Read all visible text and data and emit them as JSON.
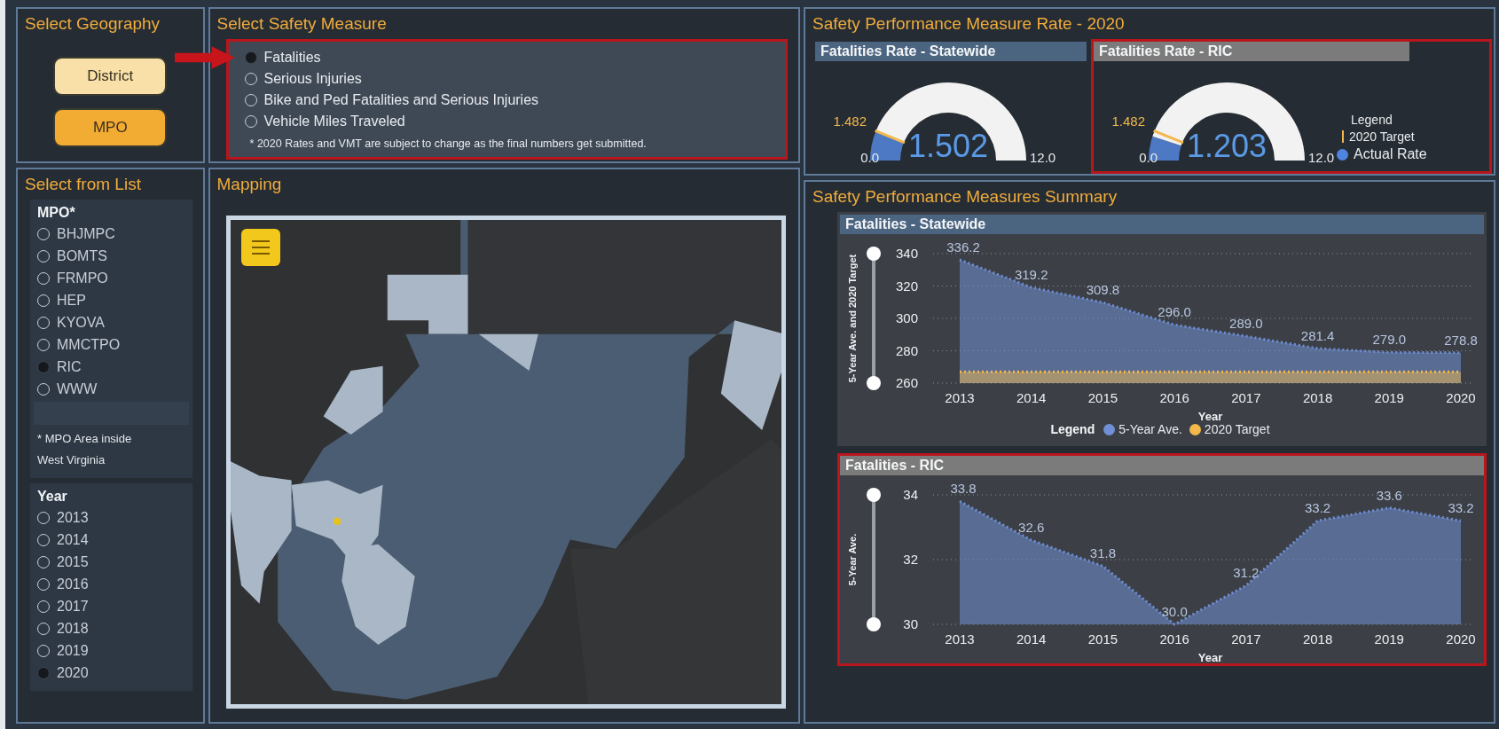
{
  "geography": {
    "title": "Select Geography",
    "buttons": [
      {
        "label": "District",
        "selected": false
      },
      {
        "label": "MPO",
        "selected": true
      }
    ]
  },
  "safety_measure": {
    "title": "Select Safety Measure",
    "highlighted": true,
    "options": [
      {
        "label": "Fatalities",
        "selected": true
      },
      {
        "label": "Serious Injuries",
        "selected": false
      },
      {
        "label": "Bike and Ped Fatalities and Serious Injuries",
        "selected": false
      },
      {
        "label": "Vehicle Miles Traveled",
        "selected": false
      }
    ],
    "note": "* 2020 Rates and VMT are subject to change as the final numbers get submitted."
  },
  "rate_panel": {
    "title": "Safety Performance Measure Rate - 2020",
    "gauges": [
      {
        "title": "Fatalities Rate - Statewide",
        "color": "#4b6480",
        "highlighted": false,
        "value": "1.502",
        "min": "0.0",
        "max": "12.0",
        "target": {
          "label": "1.482"
        }
      },
      {
        "title": "Fatalities Rate - RIC",
        "color": "#7b7b7b",
        "highlighted": true,
        "value": "1.203",
        "min": "0.0",
        "max": "12.0",
        "target": {
          "label": "1.482"
        },
        "legend": {
          "title": "Legend",
          "items": [
            {
              "kind": "bar",
              "label": "2020 Target"
            },
            {
              "kind": "dot",
              "label": "Actual Rate"
            }
          ]
        }
      }
    ]
  },
  "list_panel": {
    "title": "Select from List",
    "groups": [
      {
        "heading": "MPO*",
        "options": [
          {
            "label": "BHJMPC",
            "selected": false
          },
          {
            "label": "BOMTS",
            "selected": false
          },
          {
            "label": "FRMPO",
            "selected": false
          },
          {
            "label": "HEP",
            "selected": false
          },
          {
            "label": "KYOVA",
            "selected": false
          },
          {
            "label": "MMCTPO",
            "selected": false
          },
          {
            "label": "RIC",
            "selected": true
          },
          {
            "label": "WWW",
            "selected": false
          }
        ],
        "note": "* MPO Area inside West Virginia"
      },
      {
        "heading": "Year",
        "options": [
          {
            "label": "2013",
            "selected": false
          },
          {
            "label": "2014",
            "selected": false
          },
          {
            "label": "2015",
            "selected": false
          },
          {
            "label": "2016",
            "selected": false
          },
          {
            "label": "2017",
            "selected": false
          },
          {
            "label": "2018",
            "selected": false
          },
          {
            "label": "2019",
            "selected": false
          },
          {
            "label": "2020",
            "selected": true
          }
        ]
      }
    ]
  },
  "mapping": {
    "title": "Mapping"
  },
  "summary": {
    "title": "Safety Performance Measures Summary",
    "charts": [
      {
        "title": "Fatalities - Statewide",
        "color": "#4b6480",
        "highlighted": false,
        "legend_title": "Legend",
        "chart_data": {
          "type": "area",
          "xlabel": "Year",
          "ylabel": "5-Year Ave. and 2020 Target",
          "categories": [
            "2013",
            "2014",
            "2015",
            "2016",
            "2017",
            "2018",
            "2019",
            "2020"
          ],
          "ylim": [
            260,
            340
          ],
          "yticks": [
            260,
            280,
            300,
            320,
            340
          ],
          "grid": true,
          "series": [
            {
              "name": "5-Year Ave.",
              "color": "#6f8fd6",
              "values": [
                336.2,
                319.2,
                309.8,
                296.0,
                289.0,
                281.4,
                279.0,
                278.8
              ],
              "value_labels": [
                "336.2",
                "319.2",
                "309.8",
                "296.0",
                "289.0",
                "281.4",
                "279.0",
                "278.8"
              ]
            },
            {
              "name": "2020 Target",
              "color": "#f2b84b",
              "values": [
                267,
                267,
                267,
                267,
                267,
                267,
                267,
                267
              ]
            }
          ]
        }
      },
      {
        "title": "Fatalities - RIC",
        "color": "#7b7b7b",
        "highlighted": true,
        "chart_data": {
          "type": "area",
          "xlabel": "Year",
          "ylabel": "5-Year Ave.",
          "categories": [
            "2013",
            "2014",
            "2015",
            "2016",
            "2017",
            "2018",
            "2019",
            "2020"
          ],
          "ylim": [
            30,
            34
          ],
          "yticks": [
            30,
            32,
            34
          ],
          "grid": true,
          "series": [
            {
              "color": "#6f8fd6",
              "values": [
                33.8,
                32.6,
                31.8,
                30.0,
                31.2,
                33.2,
                33.6,
                33.2
              ],
              "value_labels": [
                "33.8",
                "32.6",
                "31.8",
                "30.0",
                "31.2",
                "33.2",
                "33.6",
                "33.2"
              ]
            }
          ]
        }
      }
    ]
  }
}
